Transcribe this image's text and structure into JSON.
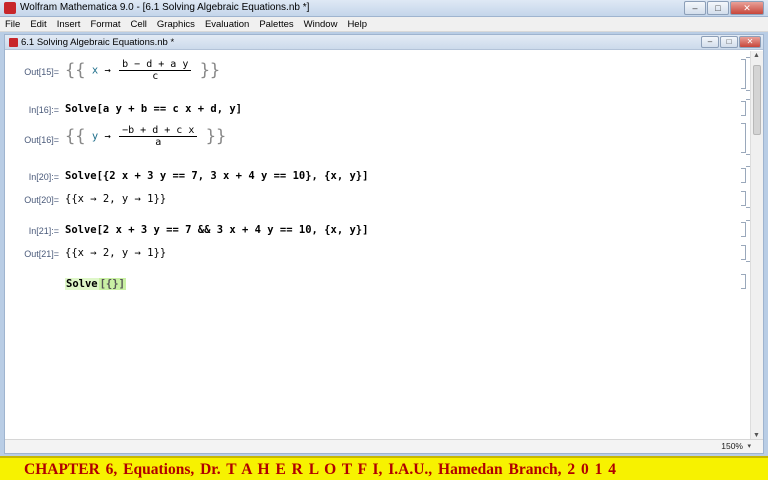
{
  "window": {
    "title": "Wolfram Mathematica 9.0 - [6.1 Solving Algebraic Equations.nb *]",
    "min_glyph": "–",
    "max_glyph": "□",
    "close_glyph": "✕"
  },
  "menu": [
    "File",
    "Edit",
    "Insert",
    "Format",
    "Cell",
    "Graphics",
    "Evaluation",
    "Palettes",
    "Window",
    "Help"
  ],
  "document": {
    "title": "6.1 Solving Algebraic Equations.nb *",
    "zoom": "150%"
  },
  "cells": {
    "out15": {
      "label": "Out[15]=",
      "var": "x",
      "arrow": "→",
      "num": "b − d + a y",
      "den": "c"
    },
    "in16": {
      "label": "In[16]:=",
      "text": "Solve[a y + b == c x + d, y]"
    },
    "out16": {
      "label": "Out[16]=",
      "var": "y",
      "arrow": "→",
      "num": "−b + d + c x",
      "den": "a"
    },
    "in20": {
      "label": "In[20]:=",
      "text": "Solve[{2 x + 3 y == 7, 3 x + 4 y == 10}, {x, y}]"
    },
    "out20": {
      "label": "Out[20]=",
      "text": "{{x → 2, y → 1}}"
    },
    "in21": {
      "label": "In[21]:=",
      "text": "Solve[2 x + 3 y == 7 && 3 x + 4 y == 10, {x, y}]"
    },
    "out21": {
      "label": "Out[21]=",
      "text": "{{x → 2, y → 1}}"
    },
    "active": {
      "keyword": "Solve",
      "brackets": "[{}]"
    }
  },
  "banner": {
    "text": "CHAPTER 6, Equations,      Dr.  T A H E R    L O T F I, I.A.U., Hamedan Branch,     2 0 1 4"
  },
  "colors": {
    "banner_bg": "#f7f200",
    "banner_text": "#b00000",
    "variable": "#1f6f8b"
  }
}
